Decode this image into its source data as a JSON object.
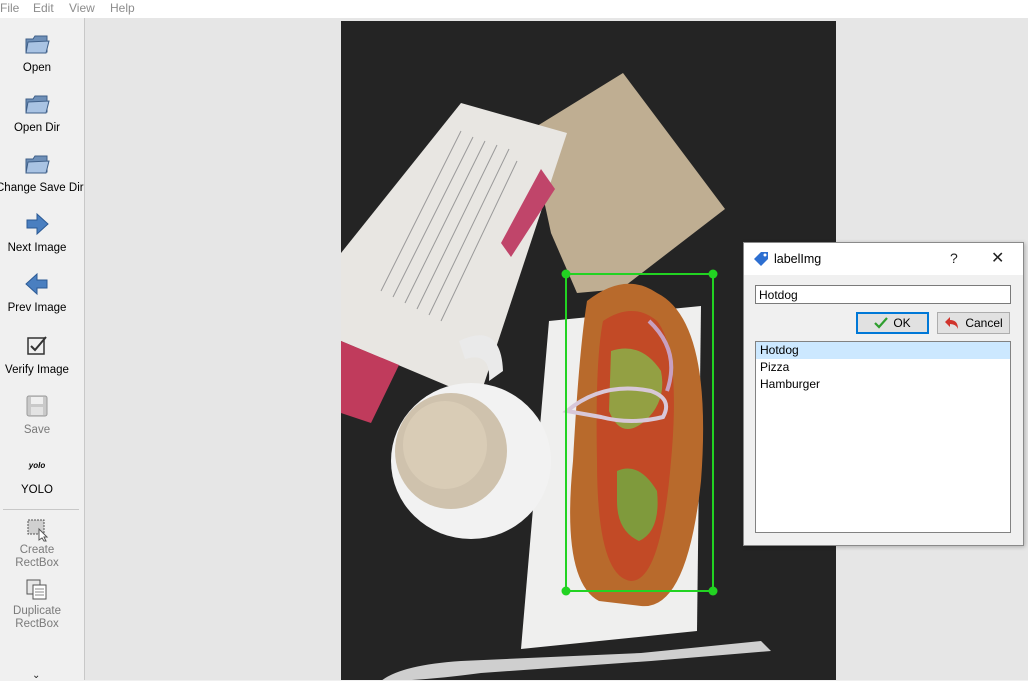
{
  "menu": {
    "file": "File",
    "edit": "Edit",
    "view": "View",
    "help": "Help"
  },
  "toolbar": {
    "open": "Open",
    "open_dir": "Open Dir",
    "change_save_dir": "Change Save Dir",
    "next_image": "Next Image",
    "prev_image": "Prev Image",
    "verify_image": "Verify Image",
    "save": "Save",
    "yolo_icon_text": "yolo",
    "yolo": "YOLO",
    "create_rectbox": "Create\nRectBox",
    "duplicate_rectbox": "Duplicate\nRectBox"
  },
  "colors": {
    "bbox": "#22d322",
    "accent": "#0078d7",
    "selection": "#cce8ff"
  },
  "dialog": {
    "title": "labelImg",
    "help_symbol": "?",
    "close_symbol": "✕",
    "input_value": "Hotdog",
    "ok_label": "OK",
    "cancel_label": "Cancel",
    "labels": [
      "Hotdog",
      "Pizza",
      "Hamburger"
    ],
    "selected_index": 0
  }
}
